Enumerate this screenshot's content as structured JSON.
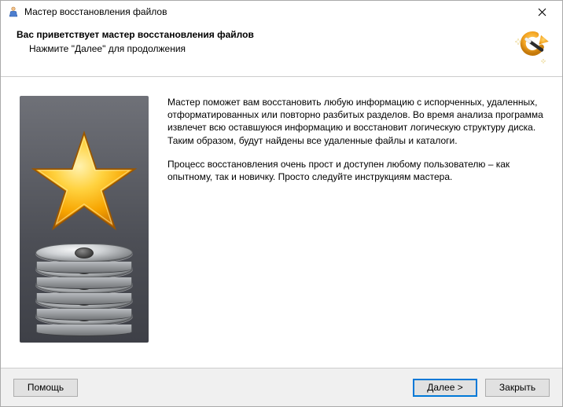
{
  "window": {
    "title": "Мастер восстановления файлов"
  },
  "header": {
    "heading": "Вас приветствует мастер восстановления файлов",
    "subtitle": "Нажмите \"Далее\" для продолжения"
  },
  "body": {
    "p1": "Мастер поможет вам восстановить любую информацию с испорченных, удаленных, отформатированных или повторно разбитых разделов. Во время анализа программа извлечет всю оставшуюся информацию и восстановит логическую структуру диска. Таким образом, будут найдены все удаленные файлы и каталоги.",
    "p2": "Процесс восстановления очень прост и доступен любому пользователю – как опытному, так и новичку. Просто следуйте инструкциям мастера."
  },
  "buttons": {
    "help": "Помощь",
    "next": "Далее >",
    "close": "Закрыть"
  },
  "icons": {
    "app": "app-icon",
    "close": "close-icon",
    "wand": "magic-wand-icon",
    "star": "star-icon",
    "disk": "disk-stack-icon"
  }
}
